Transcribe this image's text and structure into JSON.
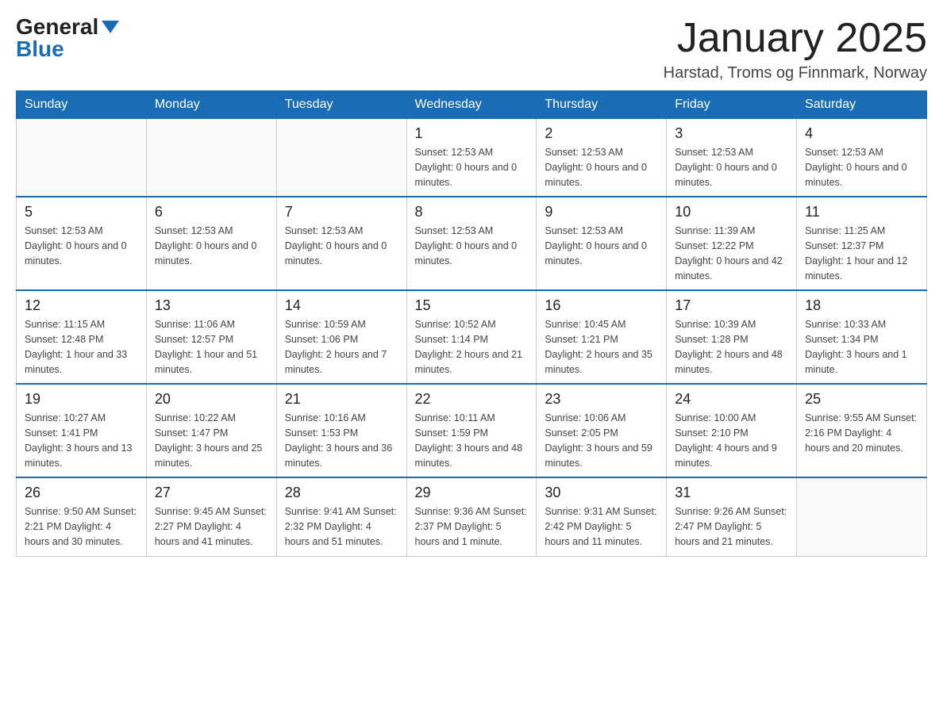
{
  "header": {
    "logo_general": "General",
    "logo_blue": "Blue",
    "title": "January 2025",
    "subtitle": "Harstad, Troms og Finnmark, Norway"
  },
  "days_of_week": [
    "Sunday",
    "Monday",
    "Tuesday",
    "Wednesday",
    "Thursday",
    "Friday",
    "Saturday"
  ],
  "weeks": [
    {
      "days": [
        {
          "num": "",
          "info": ""
        },
        {
          "num": "",
          "info": ""
        },
        {
          "num": "",
          "info": ""
        },
        {
          "num": "1",
          "info": "Sunset: 12:53 AM\nDaylight: 0 hours and 0 minutes."
        },
        {
          "num": "2",
          "info": "Sunset: 12:53 AM\nDaylight: 0 hours and 0 minutes."
        },
        {
          "num": "3",
          "info": "Sunset: 12:53 AM\nDaylight: 0 hours and 0 minutes."
        },
        {
          "num": "4",
          "info": "Sunset: 12:53 AM\nDaylight: 0 hours and 0 minutes."
        }
      ]
    },
    {
      "days": [
        {
          "num": "5",
          "info": "Sunset: 12:53 AM\nDaylight: 0 hours and 0 minutes."
        },
        {
          "num": "6",
          "info": "Sunset: 12:53 AM\nDaylight: 0 hours and 0 minutes."
        },
        {
          "num": "7",
          "info": "Sunset: 12:53 AM\nDaylight: 0 hours and 0 minutes."
        },
        {
          "num": "8",
          "info": "Sunset: 12:53 AM\nDaylight: 0 hours and 0 minutes."
        },
        {
          "num": "9",
          "info": "Sunset: 12:53 AM\nDaylight: 0 hours and 0 minutes."
        },
        {
          "num": "10",
          "info": "Sunrise: 11:39 AM\nSunset: 12:22 PM\nDaylight: 0 hours and 42 minutes."
        },
        {
          "num": "11",
          "info": "Sunrise: 11:25 AM\nSunset: 12:37 PM\nDaylight: 1 hour and 12 minutes."
        }
      ]
    },
    {
      "days": [
        {
          "num": "12",
          "info": "Sunrise: 11:15 AM\nSunset: 12:48 PM\nDaylight: 1 hour and 33 minutes."
        },
        {
          "num": "13",
          "info": "Sunrise: 11:06 AM\nSunset: 12:57 PM\nDaylight: 1 hour and 51 minutes."
        },
        {
          "num": "14",
          "info": "Sunrise: 10:59 AM\nSunset: 1:06 PM\nDaylight: 2 hours and 7 minutes."
        },
        {
          "num": "15",
          "info": "Sunrise: 10:52 AM\nSunset: 1:14 PM\nDaylight: 2 hours and 21 minutes."
        },
        {
          "num": "16",
          "info": "Sunrise: 10:45 AM\nSunset: 1:21 PM\nDaylight: 2 hours and 35 minutes."
        },
        {
          "num": "17",
          "info": "Sunrise: 10:39 AM\nSunset: 1:28 PM\nDaylight: 2 hours and 48 minutes."
        },
        {
          "num": "18",
          "info": "Sunrise: 10:33 AM\nSunset: 1:34 PM\nDaylight: 3 hours and 1 minute."
        }
      ]
    },
    {
      "days": [
        {
          "num": "19",
          "info": "Sunrise: 10:27 AM\nSunset: 1:41 PM\nDaylight: 3 hours and 13 minutes."
        },
        {
          "num": "20",
          "info": "Sunrise: 10:22 AM\nSunset: 1:47 PM\nDaylight: 3 hours and 25 minutes."
        },
        {
          "num": "21",
          "info": "Sunrise: 10:16 AM\nSunset: 1:53 PM\nDaylight: 3 hours and 36 minutes."
        },
        {
          "num": "22",
          "info": "Sunrise: 10:11 AM\nSunset: 1:59 PM\nDaylight: 3 hours and 48 minutes."
        },
        {
          "num": "23",
          "info": "Sunrise: 10:06 AM\nSunset: 2:05 PM\nDaylight: 3 hours and 59 minutes."
        },
        {
          "num": "24",
          "info": "Sunrise: 10:00 AM\nSunset: 2:10 PM\nDaylight: 4 hours and 9 minutes."
        },
        {
          "num": "25",
          "info": "Sunrise: 9:55 AM\nSunset: 2:16 PM\nDaylight: 4 hours and 20 minutes."
        }
      ]
    },
    {
      "days": [
        {
          "num": "26",
          "info": "Sunrise: 9:50 AM\nSunset: 2:21 PM\nDaylight: 4 hours and 30 minutes."
        },
        {
          "num": "27",
          "info": "Sunrise: 9:45 AM\nSunset: 2:27 PM\nDaylight: 4 hours and 41 minutes."
        },
        {
          "num": "28",
          "info": "Sunrise: 9:41 AM\nSunset: 2:32 PM\nDaylight: 4 hours and 51 minutes."
        },
        {
          "num": "29",
          "info": "Sunrise: 9:36 AM\nSunset: 2:37 PM\nDaylight: 5 hours and 1 minute."
        },
        {
          "num": "30",
          "info": "Sunrise: 9:31 AM\nSunset: 2:42 PM\nDaylight: 5 hours and 11 minutes."
        },
        {
          "num": "31",
          "info": "Sunrise: 9:26 AM\nSunset: 2:47 PM\nDaylight: 5 hours and 21 minutes."
        },
        {
          "num": "",
          "info": ""
        }
      ]
    }
  ]
}
